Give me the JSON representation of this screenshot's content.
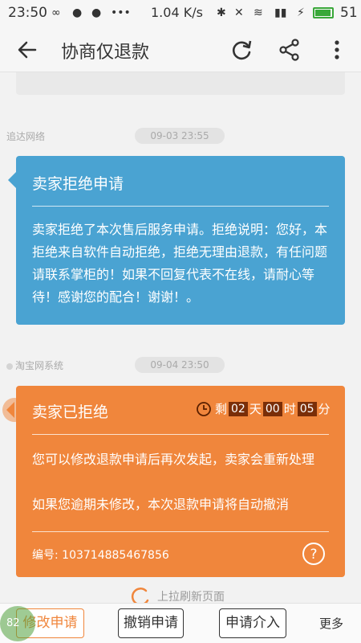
{
  "status_bar": {
    "time": "23:50",
    "speed": "1.04 K/s",
    "battery": "51",
    "colors": {
      "battery": "#3aa83a"
    }
  },
  "header": {
    "title": "协商仅退款"
  },
  "messages": [
    {
      "sender": "追达网络",
      "time": "09-03 23:55",
      "title": "卖家拒绝申请",
      "body": "卖家拒绝了本次售后服务申请。拒绝说明：您好，本拒绝来自软件自动拒绝，拒绝无理由退款，有任问题请联系掌柜的！如果不回复代表不在线，请耐心等待！感谢您的配合！谢谢！。",
      "color": "#4aa3d2"
    },
    {
      "sender": "淘宝网系统",
      "time": "09-04 23:50",
      "title": "卖家已拒绝",
      "countdown": {
        "prefix": "剩",
        "days": "02",
        "days_unit": "天",
        "hours": "00",
        "hours_unit": "时",
        "minutes": "05",
        "minutes_unit": "分"
      },
      "body_line1": "您可以修改退款申请后再次发起，卖家会重新处理",
      "body_line2": "如果您逾期未修改，本次退款申请将自动撤消",
      "serial": "编号: 103714885467856",
      "color": "#f0863c"
    }
  ],
  "loader": {
    "text": "上拉刷新页面"
  },
  "bottom_bar": {
    "buttons": [
      "修改申请",
      "撤销申请",
      "申请介入"
    ],
    "more": "更多"
  },
  "floating_badge": "82"
}
